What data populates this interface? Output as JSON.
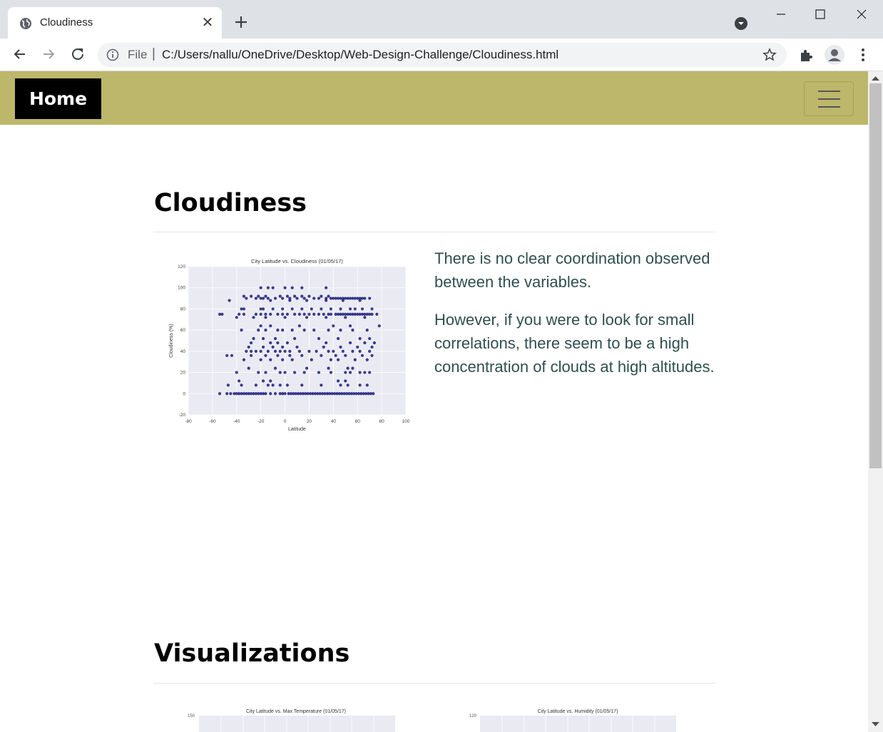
{
  "browser": {
    "tab_title": "Cloudiness",
    "tab_close": "✕",
    "url_scheme": "File",
    "url_sep": "|",
    "url": "C:/Users/nallu/OneDrive/Desktop/Web-Design-Challenge/Cloudiness.html"
  },
  "navbar": {
    "brand": "Home"
  },
  "main": {
    "heading": "Cloudiness",
    "paragraphs": [
      "There is no clear coordination observed between the variables.",
      "However, if you were to look for small correlations, there seem to be a high concentration of clouds at high altitudes."
    ]
  },
  "visualizations": {
    "heading": "Visualizations",
    "thumb_titles": [
      "City Latitude vs. Max Temperature (01/05/17)",
      "City Latitude vs. Humidity (01/05/17)"
    ],
    "thumb_first_ticks": [
      "150",
      "120"
    ]
  },
  "chart_data": {
    "type": "scatter",
    "title": "City Latitude vs. Cloudiness (01/05/17)",
    "xlabel": "Latitude",
    "ylabel": "Cloudiness (%)",
    "xlim": [
      -80,
      100
    ],
    "ylim": [
      -20,
      120
    ],
    "xticks": [
      -80,
      -60,
      -40,
      -20,
      0,
      20,
      40,
      60,
      80,
      100
    ],
    "yticks": [
      -20,
      0,
      20,
      40,
      60,
      80,
      100,
      120
    ],
    "grid": true,
    "marker_color": "#1a1a7a",
    "background": "#eaeaf2",
    "points": [
      [
        -54,
        0
      ],
      [
        -48,
        0
      ],
      [
        -45,
        0
      ],
      [
        -42,
        0
      ],
      [
        -40,
        0
      ],
      [
        -38,
        0
      ],
      [
        -36,
        0
      ],
      [
        -34,
        0
      ],
      [
        -32,
        0
      ],
      [
        -30,
        0
      ],
      [
        -28,
        0
      ],
      [
        -26,
        0
      ],
      [
        -24,
        0
      ],
      [
        -22,
        0
      ],
      [
        -20,
        0
      ],
      [
        -18,
        0
      ],
      [
        -16,
        0
      ],
      [
        -12,
        0
      ],
      [
        -8,
        0
      ],
      [
        -4,
        0
      ],
      [
        -2,
        0
      ],
      [
        0,
        0
      ],
      [
        3,
        0
      ],
      [
        5,
        0
      ],
      [
        7,
        0
      ],
      [
        9,
        0
      ],
      [
        11,
        0
      ],
      [
        13,
        0
      ],
      [
        15,
        0
      ],
      [
        17,
        0
      ],
      [
        19,
        0
      ],
      [
        21,
        0
      ],
      [
        23,
        0
      ],
      [
        25,
        0
      ],
      [
        27,
        0
      ],
      [
        29,
        0
      ],
      [
        31,
        0
      ],
      [
        33,
        0
      ],
      [
        35,
        0
      ],
      [
        37,
        0
      ],
      [
        39,
        0
      ],
      [
        41,
        0
      ],
      [
        43,
        0
      ],
      [
        45,
        0
      ],
      [
        47,
        0
      ],
      [
        49,
        0
      ],
      [
        51,
        0
      ],
      [
        53,
        0
      ],
      [
        55,
        0
      ],
      [
        57,
        0
      ],
      [
        59,
        0
      ],
      [
        61,
        0
      ],
      [
        63,
        0
      ],
      [
        65,
        0
      ],
      [
        67,
        0
      ],
      [
        69,
        0
      ],
      [
        71,
        0
      ],
      [
        73,
        0
      ],
      [
        -47,
        8
      ],
      [
        -36,
        8
      ],
      [
        -24,
        8
      ],
      [
        -14,
        8
      ],
      [
        -10,
        8
      ],
      [
        -4,
        8
      ],
      [
        2,
        8
      ],
      [
        14,
        8
      ],
      [
        30,
        8
      ],
      [
        46,
        8
      ],
      [
        52,
        8
      ],
      [
        62,
        8
      ],
      [
        68,
        8
      ],
      [
        -38,
        12
      ],
      [
        -18,
        12
      ],
      [
        -12,
        12
      ],
      [
        44,
        12
      ],
      [
        50,
        12
      ],
      [
        -40,
        20
      ],
      [
        -22,
        20
      ],
      [
        -16,
        20
      ],
      [
        -4,
        20
      ],
      [
        0,
        20
      ],
      [
        8,
        20
      ],
      [
        16,
        20
      ],
      [
        28,
        20
      ],
      [
        38,
        20
      ],
      [
        50,
        20
      ],
      [
        54,
        20
      ],
      [
        62,
        20
      ],
      [
        66,
        20
      ],
      [
        70,
        20
      ],
      [
        -30,
        24
      ],
      [
        -8,
        24
      ],
      [
        18,
        24
      ],
      [
        36,
        24
      ],
      [
        52,
        24
      ],
      [
        56,
        24
      ],
      [
        -34,
        32
      ],
      [
        -20,
        32
      ],
      [
        -12,
        32
      ],
      [
        -2,
        32
      ],
      [
        6,
        32
      ],
      [
        22,
        32
      ],
      [
        38,
        32
      ],
      [
        44,
        32
      ],
      [
        58,
        32
      ],
      [
        68,
        32
      ],
      [
        -48,
        36
      ],
      [
        -44,
        36
      ],
      [
        -28,
        36
      ],
      [
        -16,
        36
      ],
      [
        -6,
        36
      ],
      [
        4,
        36
      ],
      [
        14,
        36
      ],
      [
        30,
        36
      ],
      [
        42,
        36
      ],
      [
        50,
        36
      ],
      [
        64,
        36
      ],
      [
        72,
        36
      ],
      [
        -32,
        40
      ],
      [
        -28,
        40
      ],
      [
        -24,
        40
      ],
      [
        -20,
        40
      ],
      [
        -14,
        40
      ],
      [
        -8,
        40
      ],
      [
        -4,
        40
      ],
      [
        0,
        40
      ],
      [
        4,
        40
      ],
      [
        12,
        40
      ],
      [
        20,
        40
      ],
      [
        26,
        40
      ],
      [
        36,
        40
      ],
      [
        40,
        40
      ],
      [
        48,
        40
      ],
      [
        56,
        40
      ],
      [
        62,
        40
      ],
      [
        70,
        40
      ],
      [
        -30,
        44
      ],
      [
        -18,
        44
      ],
      [
        -10,
        44
      ],
      [
        -2,
        44
      ],
      [
        10,
        44
      ],
      [
        32,
        44
      ],
      [
        46,
        44
      ],
      [
        60,
        44
      ],
      [
        72,
        44
      ],
      [
        -28,
        48
      ],
      [
        -12,
        48
      ],
      [
        -6,
        48
      ],
      [
        2,
        48
      ],
      [
        34,
        48
      ],
      [
        54,
        48
      ],
      [
        66,
        48
      ],
      [
        74,
        48
      ],
      [
        -26,
        52
      ],
      [
        -18,
        52
      ],
      [
        -8,
        52
      ],
      [
        8,
        52
      ],
      [
        28,
        52
      ],
      [
        44,
        52
      ],
      [
        62,
        52
      ],
      [
        70,
        52
      ],
      [
        -36,
        60
      ],
      [
        -22,
        60
      ],
      [
        -16,
        60
      ],
      [
        -6,
        60
      ],
      [
        -2,
        60
      ],
      [
        6,
        60
      ],
      [
        16,
        60
      ],
      [
        24,
        60
      ],
      [
        36,
        60
      ],
      [
        46,
        60
      ],
      [
        56,
        60
      ],
      [
        68,
        60
      ],
      [
        -20,
        64
      ],
      [
        -12,
        64
      ],
      [
        12,
        64
      ],
      [
        40,
        64
      ],
      [
        54,
        64
      ],
      [
        78,
        64
      ],
      [
        -40,
        72
      ],
      [
        -26,
        72
      ],
      [
        -16,
        72
      ],
      [
        0,
        72
      ],
      [
        18,
        72
      ],
      [
        34,
        72
      ],
      [
        50,
        72
      ],
      [
        66,
        72
      ],
      [
        -54,
        75
      ],
      [
        -52,
        75
      ],
      [
        -38,
        75
      ],
      [
        -34,
        75
      ],
      [
        -24,
        75
      ],
      [
        -20,
        75
      ],
      [
        -16,
        75
      ],
      [
        -12,
        75
      ],
      [
        -6,
        75
      ],
      [
        -2,
        75
      ],
      [
        2,
        75
      ],
      [
        8,
        75
      ],
      [
        12,
        75
      ],
      [
        16,
        75
      ],
      [
        20,
        75
      ],
      [
        24,
        75
      ],
      [
        28,
        75
      ],
      [
        32,
        75
      ],
      [
        36,
        75
      ],
      [
        38,
        75
      ],
      [
        42,
        75
      ],
      [
        44,
        75
      ],
      [
        46,
        75
      ],
      [
        48,
        75
      ],
      [
        50,
        75
      ],
      [
        52,
        75
      ],
      [
        54,
        75
      ],
      [
        56,
        75
      ],
      [
        58,
        75
      ],
      [
        60,
        75
      ],
      [
        62,
        75
      ],
      [
        64,
        75
      ],
      [
        66,
        75
      ],
      [
        68,
        75
      ],
      [
        70,
        75
      ],
      [
        72,
        75
      ],
      [
        76,
        75
      ],
      [
        -36,
        80
      ],
      [
        -34,
        80
      ],
      [
        -20,
        80
      ],
      [
        -18,
        80
      ],
      [
        -10,
        80
      ],
      [
        -2,
        80
      ],
      [
        6,
        80
      ],
      [
        14,
        80
      ],
      [
        22,
        80
      ],
      [
        30,
        80
      ],
      [
        38,
        80
      ],
      [
        46,
        80
      ],
      [
        54,
        80
      ],
      [
        58,
        80
      ],
      [
        64,
        80
      ],
      [
        72,
        80
      ],
      [
        -46,
        88
      ],
      [
        -12,
        88
      ],
      [
        4,
        88
      ],
      [
        18,
        88
      ],
      [
        34,
        88
      ],
      [
        48,
        88
      ],
      [
        62,
        88
      ],
      [
        -32,
        90
      ],
      [
        -24,
        90
      ],
      [
        -20,
        90
      ],
      [
        -18,
        90
      ],
      [
        -14,
        90
      ],
      [
        -8,
        90
      ],
      [
        -2,
        90
      ],
      [
        4,
        90
      ],
      [
        10,
        90
      ],
      [
        16,
        90
      ],
      [
        24,
        90
      ],
      [
        28,
        90
      ],
      [
        34,
        90
      ],
      [
        38,
        90
      ],
      [
        40,
        90
      ],
      [
        42,
        90
      ],
      [
        44,
        90
      ],
      [
        46,
        90
      ],
      [
        48,
        90
      ],
      [
        50,
        90
      ],
      [
        52,
        90
      ],
      [
        54,
        90
      ],
      [
        56,
        90
      ],
      [
        58,
        90
      ],
      [
        60,
        90
      ],
      [
        62,
        90
      ],
      [
        64,
        90
      ],
      [
        66,
        90
      ],
      [
        70,
        90
      ],
      [
        -34,
        92
      ],
      [
        -28,
        92
      ],
      [
        -22,
        92
      ],
      [
        -16,
        92
      ],
      [
        -4,
        92
      ],
      [
        2,
        92
      ],
      [
        8,
        92
      ],
      [
        14,
        92
      ],
      [
        20,
        92
      ],
      [
        30,
        92
      ],
      [
        36,
        92
      ],
      [
        -20,
        100
      ],
      [
        -14,
        100
      ],
      [
        -10,
        100
      ],
      [
        0,
        100
      ],
      [
        6,
        100
      ],
      [
        14,
        100
      ],
      [
        34,
        100
      ]
    ]
  }
}
